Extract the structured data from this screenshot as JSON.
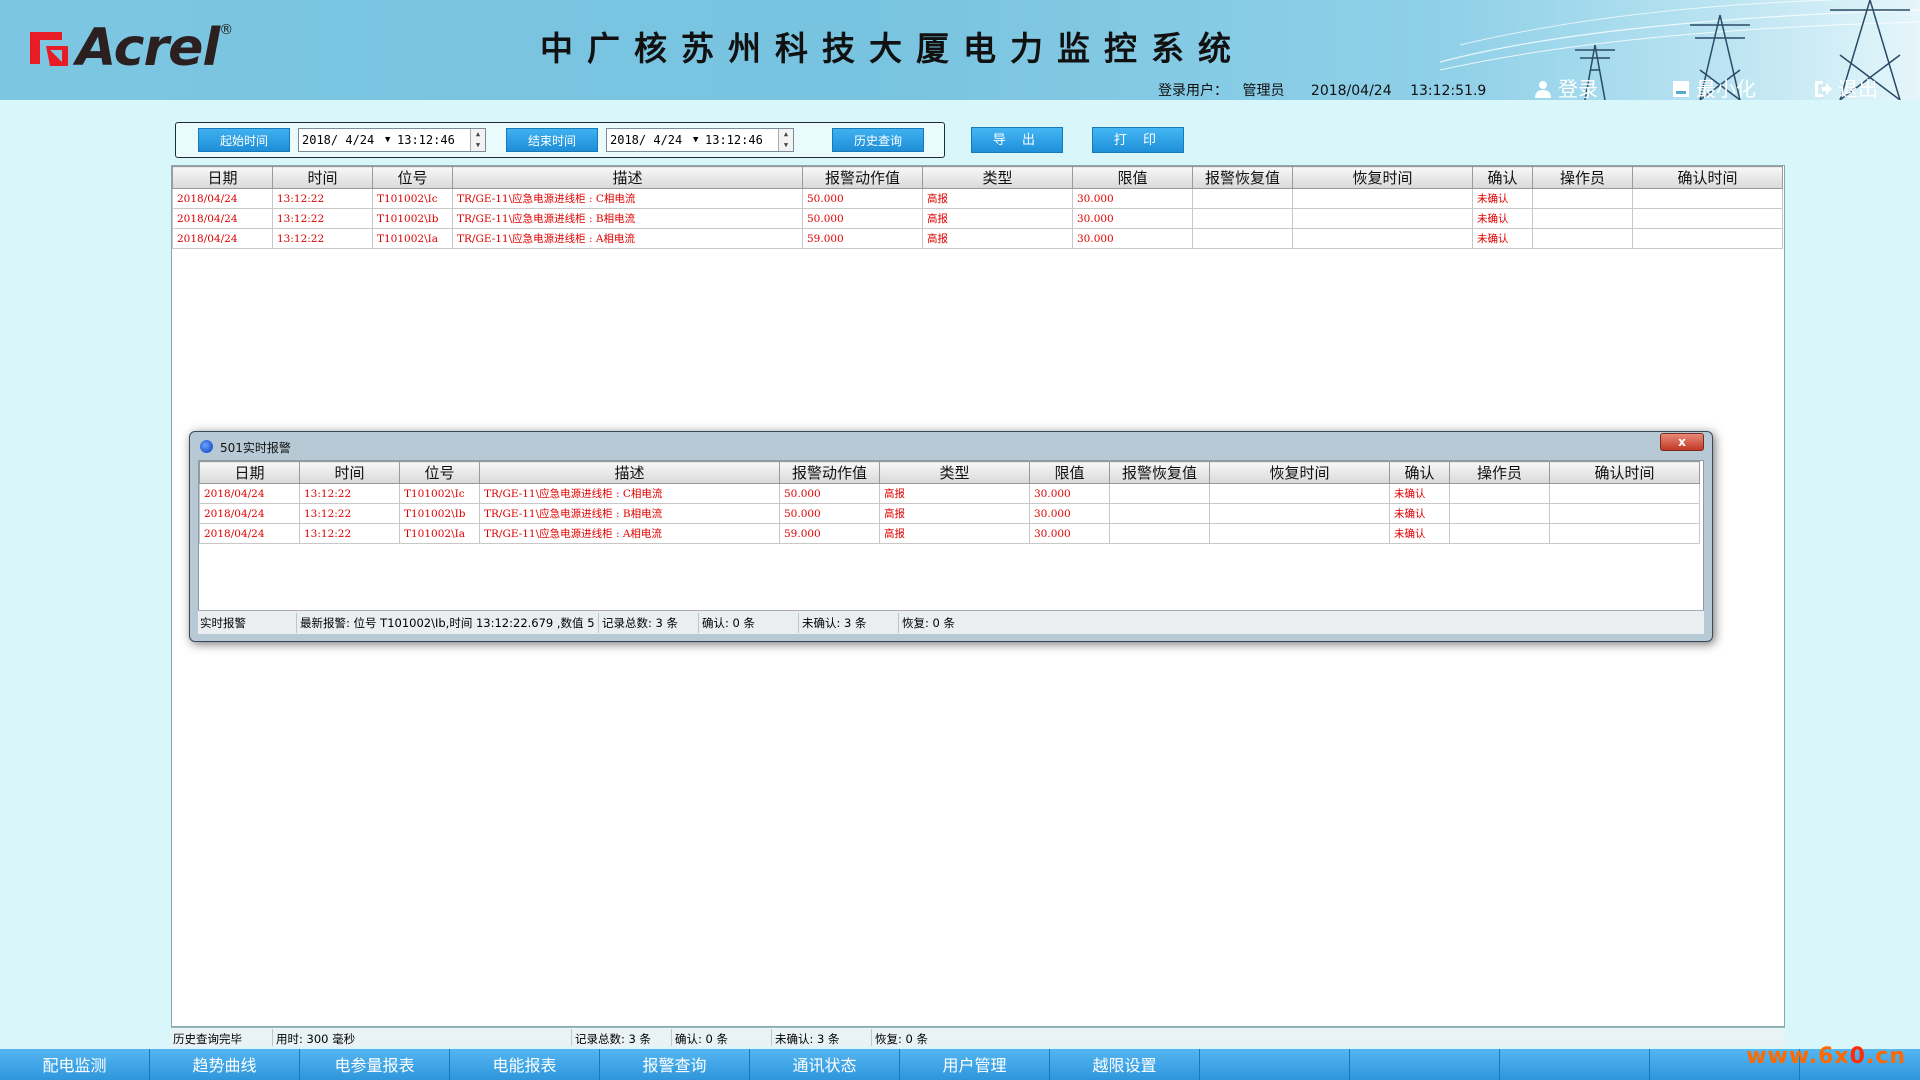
{
  "header": {
    "logo_text": "Acrel",
    "logo_reg": "®",
    "title": "中广核苏州科技大厦电力监控系统",
    "login_label": "登录用户：",
    "login_user": "管理员",
    "date": "2018/04/24",
    "time": "13:12:51.9",
    "login_btn": "登录",
    "minimize_btn": "最小化",
    "exit_btn": "退出"
  },
  "query": {
    "start_btn": "起始时间",
    "start_date": "2018/ 4/24",
    "start_time": "13:12:46",
    "end_btn": "结束时间",
    "end_date": "2018/ 4/24",
    "end_time": "13:12:46",
    "history_btn": "历史查询",
    "export_btn": "导 出",
    "print_btn": "打 印"
  },
  "columns": [
    "日期",
    "时间",
    "位号",
    "描述",
    "报警动作值",
    "类型",
    "限值",
    "报警恢复值",
    "恢复时间",
    "确认",
    "操作员",
    "确认时间"
  ],
  "rows": [
    [
      "2018/04/24",
      "13:12:22",
      "T101002\\Ic",
      "TR/GE-11\\应急电源进线柜 : C相电流",
      "50.000",
      "高报",
      "30.000",
      "",
      "",
      "未确认",
      "",
      ""
    ],
    [
      "2018/04/24",
      "13:12:22",
      "T101002\\Ib",
      "TR/GE-11\\应急电源进线柜 : B相电流",
      "50.000",
      "高报",
      "30.000",
      "",
      "",
      "未确认",
      "",
      ""
    ],
    [
      "2018/04/24",
      "13:12:22",
      "T101002\\Ia",
      "TR/GE-11\\应急电源进线柜 : A相电流",
      "59.000",
      "高报",
      "30.000",
      "",
      "",
      "未确认",
      "",
      ""
    ]
  ],
  "status": {
    "msg": "历史查询完毕",
    "elapsed": "用时: 300 毫秒",
    "total": "记录总数: 3 条",
    "confirmed": "确认: 0 条",
    "unconfirmed": "未确认: 3 条",
    "restored": "恢复: 0 条"
  },
  "popup": {
    "title": "501实时报警",
    "close": "x",
    "status_label": "实时报警",
    "latest": "最新报警: 位号 T101002\\Ib,时间 13:12:22.679 ,数值 5",
    "total": "记录总数: 3 条",
    "confirmed": "确认: 0 条",
    "unconfirmed": "未确认: 3 条",
    "restored": "恢复: 0 条"
  },
  "nav": [
    "配电监测",
    "趋势曲线",
    "电参量报表",
    "电能报表",
    "报警查询",
    "通讯状态",
    "用户管理",
    "越限设置"
  ],
  "watermark": {
    "a": "www.6x",
    "b": "0",
    "c": ".cn"
  },
  "colors": {
    "alarm_text": "#e00000",
    "header_bg": "#7cc6e2",
    "button_blue": "#1e8fd8",
    "page_bg": "#d9f7fb"
  }
}
